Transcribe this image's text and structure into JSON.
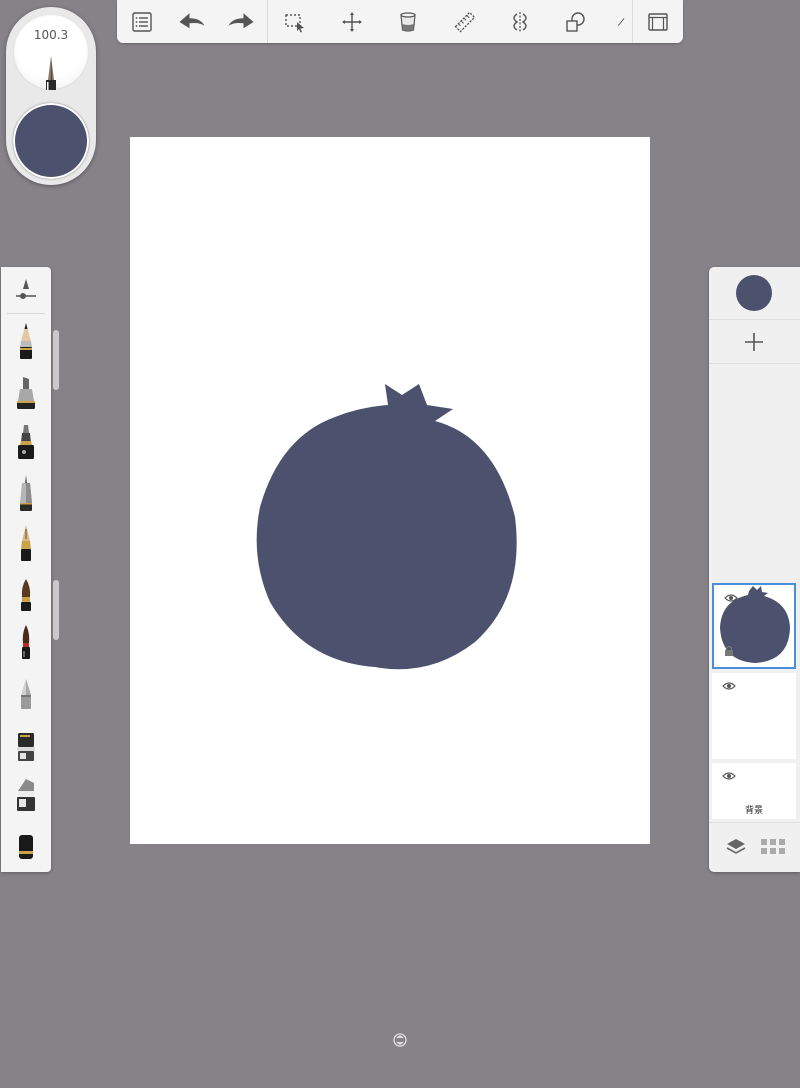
{
  "app": {
    "canvas_color": "#ffffff",
    "brush_color": "#4c516d",
    "accent": "#4a90d9"
  },
  "toolbar": {
    "items": [
      {
        "name": "menu-icon",
        "label": ""
      },
      {
        "name": "undo-icon",
        "label": ""
      },
      {
        "name": "redo-icon",
        "label": ""
      },
      {
        "name": "selection-icon",
        "label": ""
      },
      {
        "name": "transform-icon",
        "label": ""
      },
      {
        "name": "fill-bucket-icon",
        "label": ""
      },
      {
        "name": "ruler-icon",
        "label": ""
      },
      {
        "name": "symmetry-icon",
        "label": ""
      },
      {
        "name": "shapes-icon",
        "label": ""
      },
      {
        "name": "fullscreen-icon",
        "label": ""
      }
    ]
  },
  "brush_puck": {
    "size_value": "100.3"
  },
  "brush_palette": {
    "tools": [
      "brush-settings-icon",
      "pencil-icon",
      "marker-icon",
      "ink-pen-icon",
      "technical-pen-icon",
      "fountain-pen-icon",
      "paintbrush-icon",
      "wet-brush-icon",
      "smudge-icon",
      "airbrush-icon",
      "fill-marker-icon",
      "eraser-icon"
    ]
  },
  "layers": {
    "items": [
      {
        "name": "layer-1",
        "label": "",
        "visible": true,
        "selected": true
      },
      {
        "name": "layer-2",
        "label": "",
        "visible": true,
        "selected": false
      },
      {
        "name": "background-layer",
        "label": "背景",
        "visible": true,
        "selected": false
      }
    ]
  }
}
